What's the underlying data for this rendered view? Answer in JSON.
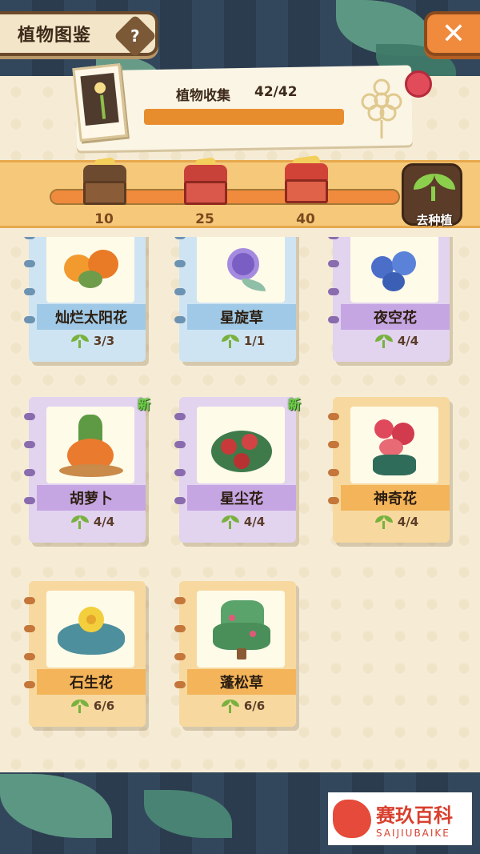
{
  "header": {
    "title": "植物图鉴",
    "help_icon": "?",
    "close_icon": "✕"
  },
  "collection": {
    "label": "植物收集",
    "count": "42/42",
    "progress": 1.0
  },
  "rewards": {
    "progress": 1.0,
    "milestones": [
      {
        "value": "10",
        "chest": "bronze-chest-icon"
      },
      {
        "value": "25",
        "chest": "red-chest-icon"
      },
      {
        "value": "40",
        "chest": "grand-chest-icon"
      }
    ],
    "go_plant_label": "去种植"
  },
  "plants": [
    {
      "name": "灿烂太阳花",
      "count": "3/3",
      "theme": "blue",
      "new": ""
    },
    {
      "name": "星旋草",
      "count": "1/1",
      "theme": "blue",
      "new": ""
    },
    {
      "name": "夜空花",
      "count": "4/4",
      "theme": "purple",
      "new": ""
    },
    {
      "name": "胡萝卜",
      "count": "4/4",
      "theme": "purple",
      "new": "新"
    },
    {
      "name": "星尘花",
      "count": "4/4",
      "theme": "purple",
      "new": "新"
    },
    {
      "name": "神奇花",
      "count": "4/4",
      "theme": "orange",
      "new": ""
    },
    {
      "name": "石生花",
      "count": "6/6",
      "theme": "orange",
      "new": ""
    },
    {
      "name": "蓬松草",
      "count": "6/6",
      "theme": "orange",
      "new": ""
    }
  ],
  "watermark": {
    "cn": "赛玖百科",
    "en": "SAIJIUBAIKE"
  },
  "colors": {
    "accent": "#f08a3c",
    "panel": "#f6ecd6",
    "brand_red": "#d8402e"
  }
}
